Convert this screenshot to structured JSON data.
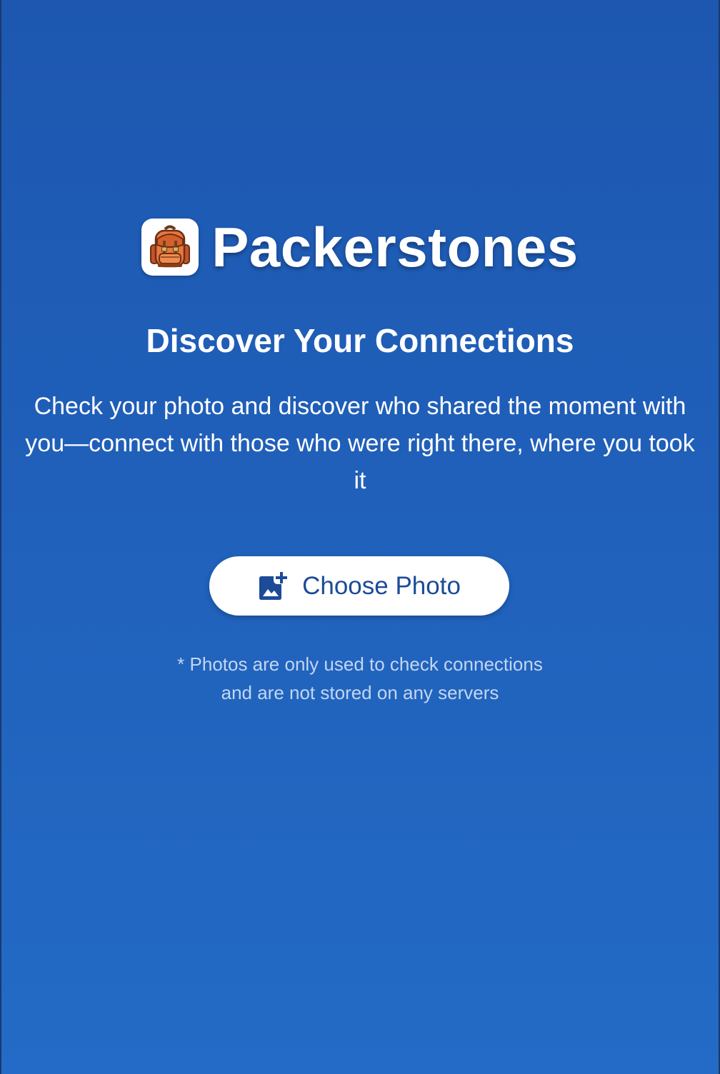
{
  "brand": {
    "app_name": "Packerstones",
    "logo_icon": "backpack-icon"
  },
  "main": {
    "headline": "Discover Your Connections",
    "description": "Check your photo and discover who shared the moment with you—connect with those who were right there, where you took it",
    "choose_button": {
      "label": "Choose Photo",
      "icon": "add-photo-icon"
    },
    "disclaimer_line1": "* Photos are only used to check connections",
    "disclaimer_line2": "and are not stored on any servers"
  },
  "colors": {
    "background_top": "#1d57b0",
    "background_bottom": "#236bc6",
    "button_background": "#ffffff",
    "button_text": "#1c4b98",
    "disclaimer_text": "#c3d6f1"
  }
}
